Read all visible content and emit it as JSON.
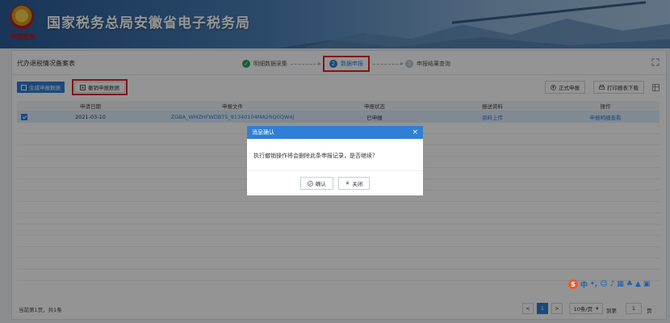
{
  "header": {
    "title": "国家税务总局安徽省电子税务局",
    "emblem_caption": "中国税务"
  },
  "page": {
    "title": "代办退税情况备案表",
    "steps": [
      {
        "num": "✓",
        "label": "明细数据采集"
      },
      {
        "num": "2",
        "label": "数据申报"
      },
      {
        "num": "3",
        "label": "申报结果查询"
      }
    ]
  },
  "toolbar": {
    "generate_label": "生成申报数据",
    "cancel_label": "撤销申报数据",
    "formal_label": "正式申报",
    "print_label": "打印报表下载"
  },
  "table": {
    "headers": [
      "申请日期",
      "申报文件",
      "申报状态",
      "报送资料",
      "操作"
    ],
    "rows": [
      {
        "date": "2021-03-10",
        "file": "ZGBA_WMZHFWDBTS_91340104MA2RQ0QW4J",
        "status": "已申报",
        "material": "资料上传",
        "action": "申报明细查看"
      }
    ]
  },
  "footer": {
    "info": "当前第1页，共1条",
    "prev": "<",
    "page": "1",
    "next": ">",
    "page_size": "10条/页",
    "goto_label": "到第",
    "goto_value": "1",
    "page_unit": "页"
  },
  "modal": {
    "title": "消息确认",
    "close": "×",
    "message": "执行撤销操作将会删除此条申报记录，是否继续？",
    "confirm_label": "确认",
    "close_label": "关闭"
  },
  "ime": {
    "logo": "S",
    "lang": "中"
  },
  "colors": {
    "primary": "#2f7fd6",
    "highlight": "#e0231f",
    "done": "#26a267"
  }
}
